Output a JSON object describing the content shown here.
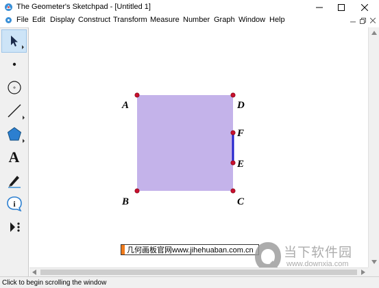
{
  "window": {
    "title": "The Geometer's Sketchpad - [Untitled 1]",
    "controls": [
      "minimize",
      "maximize",
      "close"
    ]
  },
  "menubar": {
    "items": [
      "File",
      "Edit",
      "Display",
      "Construct",
      "Transform",
      "Measure",
      "Number",
      "Graph",
      "Window",
      "Help"
    ]
  },
  "toolbox": {
    "tools": [
      {
        "name": "arrow-tool",
        "icon": "arrow-pointer-icon",
        "selected": true
      },
      {
        "name": "point-tool",
        "icon": "point-icon"
      },
      {
        "name": "compass-tool",
        "icon": "circle-icon"
      },
      {
        "name": "straightedge-tool",
        "icon": "line-segment-icon"
      },
      {
        "name": "polygon-tool",
        "icon": "pentagon-icon"
      },
      {
        "name": "text-tool",
        "icon": "text-a-icon",
        "label": "A"
      },
      {
        "name": "marker-tool",
        "icon": "pen-icon"
      },
      {
        "name": "information-tool",
        "icon": "info-icon",
        "label": "i"
      },
      {
        "name": "custom-tool",
        "icon": "custom-tools-icon"
      }
    ]
  },
  "sketch": {
    "square_fill": "#c4b3ea",
    "point_color": "#c8102e",
    "segment_color": "#2222cc",
    "points": {
      "A": "A",
      "B": "B",
      "C": "C",
      "D": "D",
      "E": "E",
      "F": "F"
    }
  },
  "caption": {
    "text": "几何画板官网www.jihehuaban.com.cn"
  },
  "watermark": {
    "brand": "当下软件园",
    "url": "www.downxia.com"
  },
  "status": {
    "text": "Click to begin scrolling the window"
  }
}
